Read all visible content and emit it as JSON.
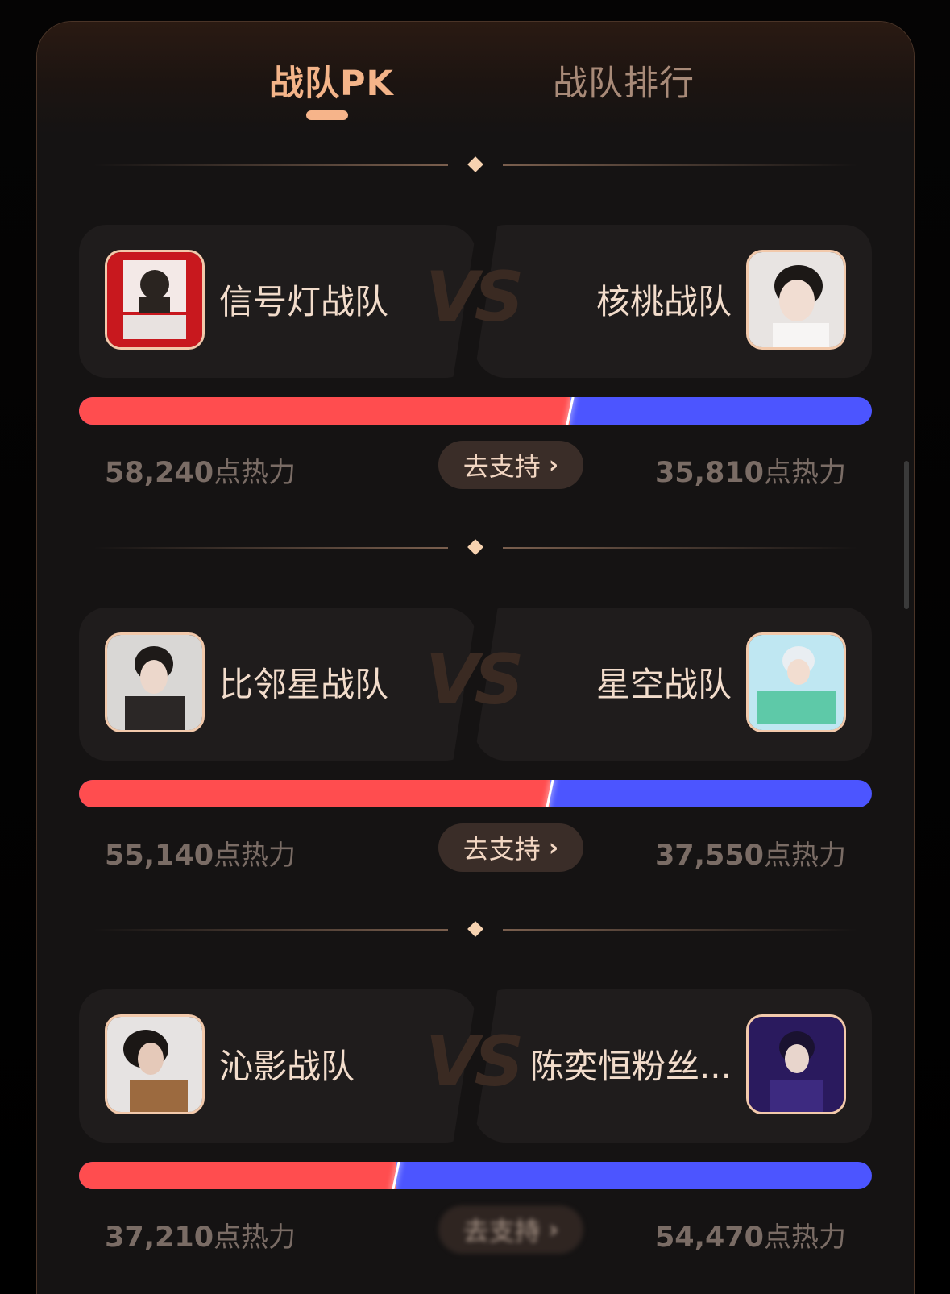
{
  "tabs": [
    {
      "label": "战队PK",
      "active": true
    },
    {
      "label": "战队排行",
      "active": false
    }
  ],
  "vs_label": "VS",
  "support_label": "去支持",
  "chevron_glyph": "›",
  "heat_unit": "点热力",
  "colors": {
    "left_bar": "#ff4d4f",
    "right_bar": "#4c55ff",
    "accent": "#f4b489"
  },
  "matches": [
    {
      "left": {
        "name": "信号灯战队",
        "score": "58,240",
        "avatar_icon": "team-avatar-photo"
      },
      "right": {
        "name": "核桃战队",
        "score": "35,810",
        "avatar_icon": "team-avatar-photo"
      },
      "left_share": 0.62
    },
    {
      "left": {
        "name": "比邻星战队",
        "score": "55,140",
        "avatar_icon": "team-avatar-photo"
      },
      "right": {
        "name": "星空战队",
        "score": "37,550",
        "avatar_icon": "team-avatar-photo"
      },
      "left_share": 0.595
    },
    {
      "left": {
        "name": "沁影战队",
        "score": "37,210",
        "avatar_icon": "team-avatar-photo"
      },
      "right": {
        "name": "陈奕恒粉丝...",
        "score": "54,470",
        "avatar_icon": "team-avatar-photo"
      },
      "left_share": 0.4
    }
  ]
}
